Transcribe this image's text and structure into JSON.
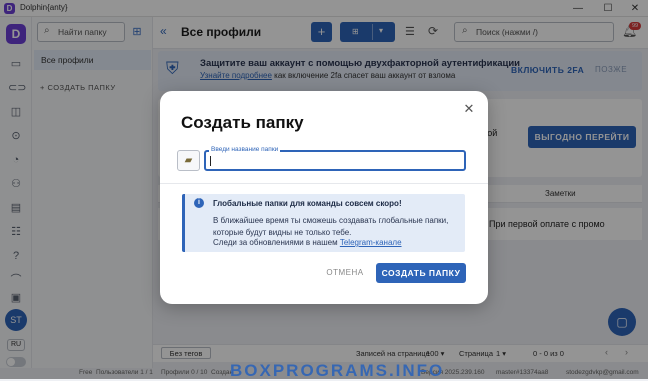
{
  "window": {
    "title": "Dolphin{anty}",
    "minimize": "—",
    "maximize": "☐",
    "close": "✕"
  },
  "rail": {
    "brand": "D",
    "avatar": "ST",
    "lang": "RU"
  },
  "folders": {
    "search_placeholder": "Найти папку",
    "all_profiles": "Все профили",
    "create_folder": "+ СОЗДАТЬ ПАПКУ"
  },
  "header": {
    "title": "Все профили",
    "add": "+",
    "search_placeholder": "Поиск (нажми /)",
    "notif_count": "99"
  },
  "banner": {
    "title": "Защитите ваш аккаунт с помощью двухфакторной аутентификации",
    "sub_link": "Узнайте подробнее",
    "sub_rest": " как включение 2fa спасет ваш аккаунт от взлома",
    "enable": "ВКЛЮЧИТЬ 2FA",
    "later": "ПОЗЖЕ"
  },
  "promo": {
    "text": "дкой",
    "button": "ВЫГОДНО ПЕРЕЙТИ"
  },
  "table": {
    "col_notes": "Заметки",
    "promo_row": "При первой оплате с промо"
  },
  "footer": {
    "no_tags": "Без тегов",
    "rows_label": "Записей на странице",
    "rows_value": "100 ▾",
    "page_label": "Страница",
    "page_value": "1 ▾",
    "range": "0 - 0 из 0",
    "prev": "‹",
    "next": "›"
  },
  "status": {
    "plan": "Free",
    "users": "Пользователи 1 / 1",
    "profiles": "Профили 0 / 10",
    "created": "Создан",
    "version": "Версия 2025.239.160",
    "master": "master#13374aa8",
    "email": "stodezgdvkp@gmail.com"
  },
  "watermark": "BOXPROGRAMS.INFO",
  "modal": {
    "title": "Создать папку",
    "close": "✕",
    "input_label": "Введи название папки",
    "info_title": "Глобальные папки для команды совсем скоро!",
    "info_line1": "В ближайшее время ты сможешь создавать глобальные папки,",
    "info_line2": "которые будут видны не только тебе.",
    "info_line3_prefix": "Следи за обновлениями в нашем ",
    "info_link": "Telegram-канале",
    "cancel": "ОТМЕНА",
    "create": "СОЗДАТЬ ПАПКУ"
  },
  "colors": {
    "accent": "#2e64b8",
    "brand": "#6b3fd6",
    "badge": "#d73b3b"
  }
}
